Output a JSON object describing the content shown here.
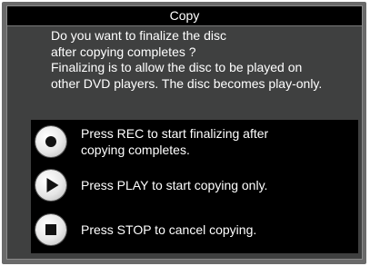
{
  "dialog": {
    "title": "Copy",
    "message_lines": [
      "Do you want to finalize the disc",
      "after copying completes ?",
      "Finalizing is to allow the disc to be played on",
      "other DVD players. The disc becomes play-only."
    ]
  },
  "options": [
    {
      "icon": "record-icon",
      "label_lines": [
        "Press REC to start finalizing after",
        "copying completes."
      ]
    },
    {
      "icon": "play-icon",
      "label_lines": [
        "Press PLAY to start copying only."
      ]
    },
    {
      "icon": "stop-icon",
      "label_lines": [
        "Press STOP to cancel copying."
      ]
    }
  ],
  "colors": {
    "title_bar_bg": "#000000",
    "dialog_bg": "#3f4040",
    "frame": "#6a6a6a",
    "options_bg": "#000000",
    "text": "#ffffff"
  }
}
